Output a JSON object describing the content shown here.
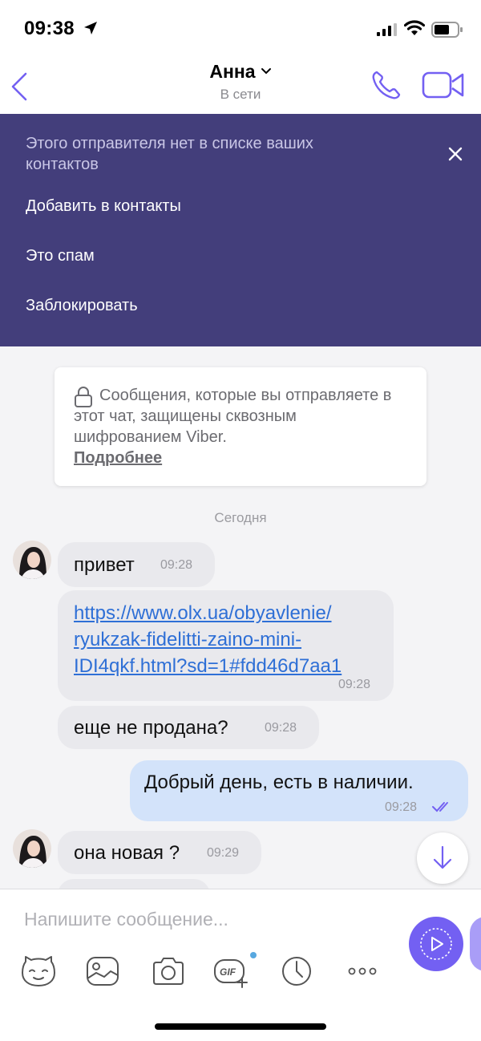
{
  "status_bar": {
    "time": "09:38"
  },
  "header": {
    "contact_name": "Анна",
    "contact_status": "В сети"
  },
  "banner": {
    "note": "Этого отправителя нет в списке ваших контактов",
    "actions": [
      "Добавить в контакты",
      "Это спам",
      "Заблокировать"
    ]
  },
  "chat": {
    "e2e_notice": "Сообщения, которые вы отправляете в этот чат, защищены сквозным шифрованием Viber.",
    "e2e_link": "Подробнее",
    "date_separator": "Сегодня",
    "messages": [
      {
        "direction": "in",
        "text": "привет",
        "time": "09:28"
      },
      {
        "direction": "in",
        "text": "https://www.olx.ua/obyavlenie/ryukzak-fidelitti-zaino-mini-IDI4qkf.html?sd=1#fdd46d7aa1",
        "link_lines": [
          "https://www.olx.ua/obyavlenie/",
          "ryukzak-fidelitti-zaino-mini-",
          "IDI4qkf.html?sd=1#fdd46d7aa1"
        ],
        "time": "09:28"
      },
      {
        "direction": "in",
        "text": "еще не продана?",
        "time": "09:28"
      },
      {
        "direction": "out",
        "text": "Добрый день, есть в наличии.",
        "time": "09:28",
        "status": "read"
      },
      {
        "direction": "in",
        "text": "она новая ?",
        "time": "09:29"
      }
    ]
  },
  "composer": {
    "placeholder": "Напишите сообщение...",
    "tools": [
      "sticker-icon",
      "gallery-icon",
      "camera-icon",
      "gif-icon",
      "timer-icon",
      "more-icon"
    ]
  },
  "colors": {
    "accent": "#7360f2",
    "banner": "#433e7b",
    "outgoing_bubble": "#d3e3fa",
    "incoming_bubble": "#e9e9ed",
    "link": "#2e6fd6"
  }
}
